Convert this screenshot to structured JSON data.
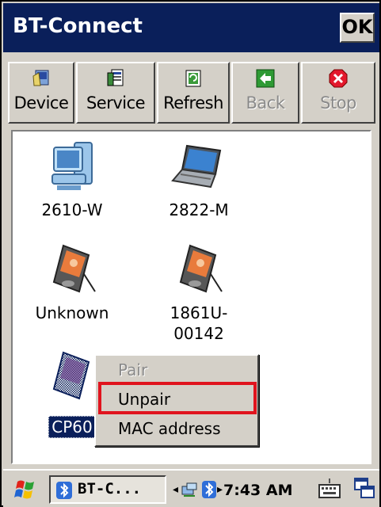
{
  "window": {
    "title": "BT-Connect",
    "ok_label": "OK"
  },
  "toolbar": {
    "buttons": [
      {
        "label": "Device",
        "icon": "device-icon",
        "enabled": true
      },
      {
        "label": "Service",
        "icon": "service-icon",
        "enabled": true
      },
      {
        "label": "Refresh",
        "icon": "refresh-icon",
        "enabled": true
      },
      {
        "label": "Back",
        "icon": "back-arrow-icon",
        "enabled": false
      },
      {
        "label": "Stop",
        "icon": "stop-icon",
        "enabled": false
      }
    ]
  },
  "devices": [
    {
      "name": "2610-W",
      "icon": "desktop-computer-icon"
    },
    {
      "name": "2822-M",
      "icon": "laptop-icon"
    },
    {
      "name": "Unknown",
      "icon": "pda-icon"
    },
    {
      "name_line1": "1861U-",
      "name_line2": "00142",
      "icon": "pda-icon"
    },
    {
      "name": "CP60",
      "icon": "pda-icon",
      "selected": true
    }
  ],
  "context_menu": {
    "items": [
      {
        "label": "Pair",
        "enabled": false
      },
      {
        "label": "Unpair",
        "enabled": true,
        "highlighted": true
      },
      {
        "label": "MAC address",
        "enabled": true
      }
    ]
  },
  "taskbar": {
    "task_label": "BT-C...",
    "clock": "7:43 AM"
  },
  "colors": {
    "title_bar": "#0a1f5a",
    "chrome": "#d4d0c8",
    "highlight_box": "#e0141e"
  }
}
